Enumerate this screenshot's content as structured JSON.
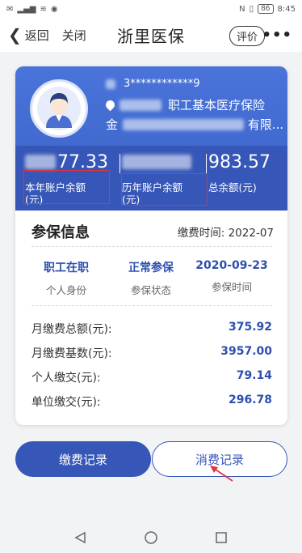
{
  "status_bar": {
    "time": "8:45",
    "battery": "86"
  },
  "nav": {
    "back_label": "返回",
    "close_label": "关闭",
    "title": "浙里医保",
    "rate_label": "评价",
    "more_label": "•••"
  },
  "profile": {
    "id_masked": "3************9",
    "insurance_type": "职工基本医疗保险",
    "org_prefix": "金",
    "org_suffix": "有限..."
  },
  "balances": {
    "current_year_value": "77.33",
    "current_year_label": "本年账户余额(元)",
    "history_label": "历年账户余额(元)",
    "total_value": "983.57",
    "total_label": "总余额(元)"
  },
  "insured_info": {
    "title": "参保信息",
    "pay_time_label": "缴费时间:",
    "pay_time_value": "2022-07",
    "status_items": [
      {
        "value": "职工在职",
        "label": "个人身份"
      },
      {
        "value": "正常参保",
        "label": "参保状态"
      },
      {
        "value": "2020-09-23",
        "label": "参保时间"
      }
    ],
    "fees": [
      {
        "label": "月缴费总额(元):",
        "value": "375.92"
      },
      {
        "label": "月缴费基数(元):",
        "value": "3957.00"
      },
      {
        "label": "个人缴交(元):",
        "value": "79.14"
      },
      {
        "label": "单位缴交(元):",
        "value": "296.78"
      }
    ]
  },
  "buttons": {
    "payment_records": "缴费记录",
    "consumption_records": "消费记录"
  },
  "colors": {
    "primary": "#3657b8",
    "header_gradient_top": "#4a74d9",
    "accent_text": "#2d4fb0",
    "annotation_red": "#e0343c"
  }
}
